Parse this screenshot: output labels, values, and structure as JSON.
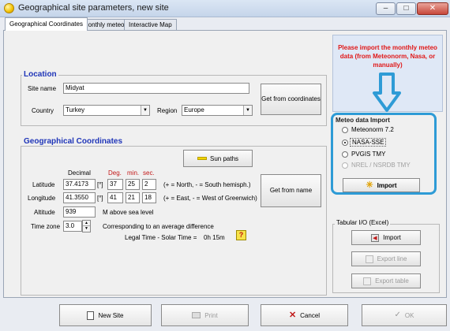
{
  "window": {
    "title": "Geographical site parameters, new site",
    "controls": {
      "minimize": "–",
      "maximize": "□",
      "close": "✕"
    }
  },
  "tabs": [
    {
      "label": "Geographical Coordinates",
      "active": true
    },
    {
      "label": "Monthly meteo"
    },
    {
      "label": "Interactive Map"
    }
  ],
  "location": {
    "title": "Location",
    "site_name_label": "Site name",
    "site_name_value": "Midyat",
    "country_label": "Country",
    "country_value": "Turkey",
    "region_label": "Region",
    "region_value": "Europe",
    "get_from_coords_button": "Get from coordinates"
  },
  "coords": {
    "title": "Geographical Coordinates",
    "sun_paths_button": "Sun paths",
    "decimal_header": "Decimal",
    "deg_header": "Deg.",
    "min_header": "min.",
    "sec_header": "sec.",
    "latitude_label": "Latitude",
    "latitude_decimal": "37.4173",
    "latitude_unit": "[°]",
    "latitude_deg": "37",
    "latitude_min": "25",
    "latitude_sec": "2",
    "latitude_hint": "(+ = North, - = South hemisph.)",
    "longitude_label": "Longitude",
    "longitude_decimal": "41.3550",
    "longitude_unit": "[°]",
    "longitude_deg": "41",
    "longitude_min": "21",
    "longitude_sec": "18",
    "longitude_hint": "(+ = East, - = West of Greenwich)",
    "altitude_label": "Altitude",
    "altitude_value": "939",
    "altitude_hint": "M above sea level",
    "timezone_label": "Time zone",
    "timezone_value": "3.0",
    "timezone_hint": "Corresponding to an average difference",
    "legal_time_label": "Legal Time - Solar Time =",
    "legal_time_value": "0h 15m",
    "get_from_name_button": "Get from name",
    "help_glyph": "?"
  },
  "meteo_notice": "Please import the monthly meteo data (from Meteonorm, Nasa, or manually)",
  "meteo_import": {
    "title": "Meteo data Import",
    "options": [
      {
        "label": "Meteonorm 7.2",
        "selected": false,
        "enabled": true
      },
      {
        "label": "NASA-SSE",
        "selected": true,
        "enabled": true
      },
      {
        "label": "PVGIS TMY",
        "selected": false,
        "enabled": true
      },
      {
        "label": "NREL / NSRDB TMY",
        "selected": false,
        "enabled": false
      }
    ],
    "import_button": "Import",
    "highlight_color": "#2e9bd6"
  },
  "tabular_io": {
    "title": "Tabular I/O (Excel)",
    "import_button": "Import",
    "export_line_button": "Export line",
    "export_table_button": "Export table"
  },
  "bottom_buttons": {
    "new_site": "New Site",
    "print": "Print",
    "cancel": "Cancel",
    "ok": "OK"
  }
}
